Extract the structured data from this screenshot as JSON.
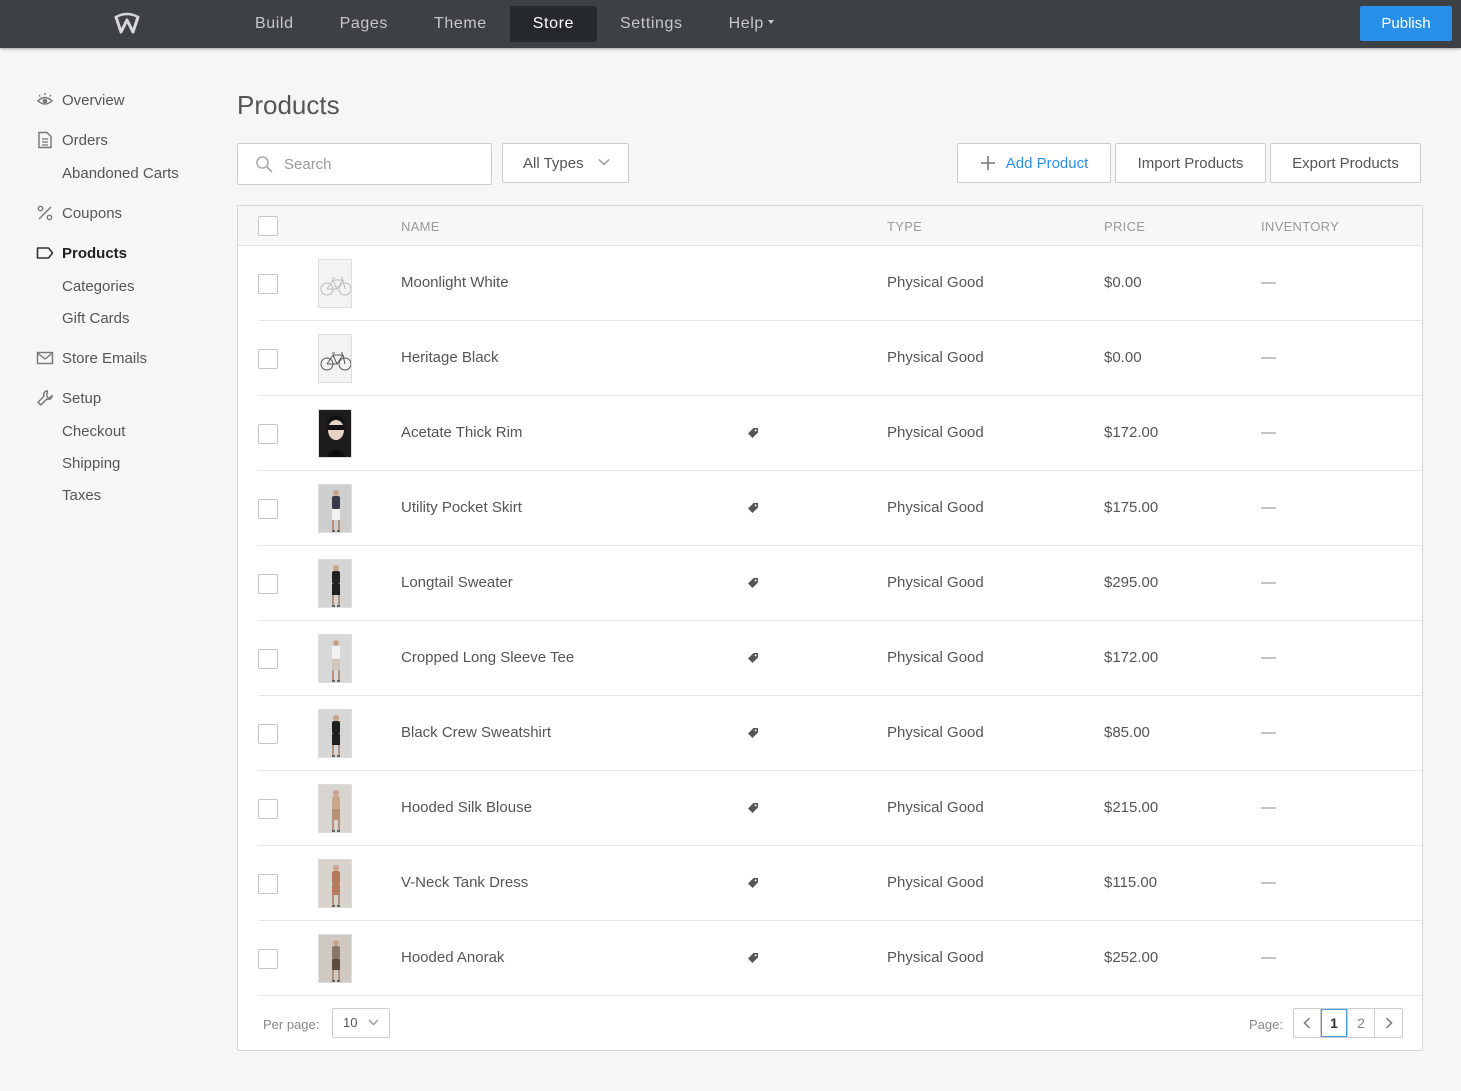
{
  "topbar": {
    "logo_icon": "weebly-w-logo",
    "nav": [
      {
        "label": "Build"
      },
      {
        "label": "Pages"
      },
      {
        "label": "Theme"
      },
      {
        "label": "Store"
      },
      {
        "label": "Settings"
      },
      {
        "label": "Help"
      }
    ],
    "active_nav": "Store",
    "publish_label": "Publish",
    "publish_color": "#2990ea"
  },
  "sidebar": {
    "items": [
      {
        "label": "Overview",
        "icon": "eye-icon"
      },
      {
        "label": "Orders",
        "icon": "document-icon"
      },
      {
        "label": "Abandoned Carts"
      },
      {
        "label": "Coupons",
        "icon": "percent-icon"
      },
      {
        "label": "Products",
        "icon": "tag-outline-icon",
        "active": true
      },
      {
        "label": "Categories"
      },
      {
        "label": "Gift Cards"
      },
      {
        "label": "Store Emails",
        "icon": "envelope-icon"
      },
      {
        "label": "Setup",
        "icon": "wrench-icon"
      },
      {
        "label": "Checkout"
      },
      {
        "label": "Shipping"
      },
      {
        "label": "Taxes"
      }
    ]
  },
  "page": {
    "title": "Products",
    "search_placeholder": "Search",
    "filter_value": "All Types",
    "add_product_label": "Add Product",
    "import_label": "Import Products",
    "export_label": "Export Products",
    "accent_color": "#2a8ee6"
  },
  "table": {
    "columns": {
      "name": "NAME",
      "type": "TYPE",
      "price": "PRICE",
      "inventory": "INVENTORY"
    },
    "rows": [
      {
        "name": "Moonlight White",
        "type": "Physical Good",
        "price": "$0.00",
        "inventory": "—",
        "on_sale": false,
        "thumb": "bicycle-white"
      },
      {
        "name": "Heritage Black",
        "type": "Physical Good",
        "price": "$0.00",
        "inventory": "—",
        "on_sale": false,
        "thumb": "bicycle-black"
      },
      {
        "name": "Acetate Thick Rim",
        "type": "Physical Good",
        "price": "$172.00",
        "inventory": "—",
        "on_sale": true,
        "thumb": "sunglasses-model"
      },
      {
        "name": "Utility Pocket Skirt",
        "type": "Physical Good",
        "price": "$175.00",
        "inventory": "—",
        "on_sale": true,
        "thumb": "skirt-model"
      },
      {
        "name": "Longtail Sweater",
        "type": "Physical Good",
        "price": "$295.00",
        "inventory": "—",
        "on_sale": true,
        "thumb": "sweater-model"
      },
      {
        "name": "Cropped Long Sleeve Tee",
        "type": "Physical Good",
        "price": "$172.00",
        "inventory": "—",
        "on_sale": true,
        "thumb": "tee-model"
      },
      {
        "name": "Black Crew Sweatshirt",
        "type": "Physical Good",
        "price": "$85.00",
        "inventory": "—",
        "on_sale": true,
        "thumb": "sweatshirt-model"
      },
      {
        "name": "Hooded Silk Blouse",
        "type": "Physical Good",
        "price": "$215.00",
        "inventory": "—",
        "on_sale": true,
        "thumb": "blouse-model"
      },
      {
        "name": "V-Neck Tank Dress",
        "type": "Physical Good",
        "price": "$115.00",
        "inventory": "—",
        "on_sale": true,
        "thumb": "dress-model"
      },
      {
        "name": "Hooded Anorak",
        "type": "Physical Good",
        "price": "$252.00",
        "inventory": "—",
        "on_sale": true,
        "thumb": "anorak-model"
      }
    ]
  },
  "footer": {
    "per_page_label": "Per page:",
    "per_page_value": "10",
    "page_label": "Page:",
    "pages": [
      "1",
      "2"
    ],
    "current_page": "1"
  }
}
